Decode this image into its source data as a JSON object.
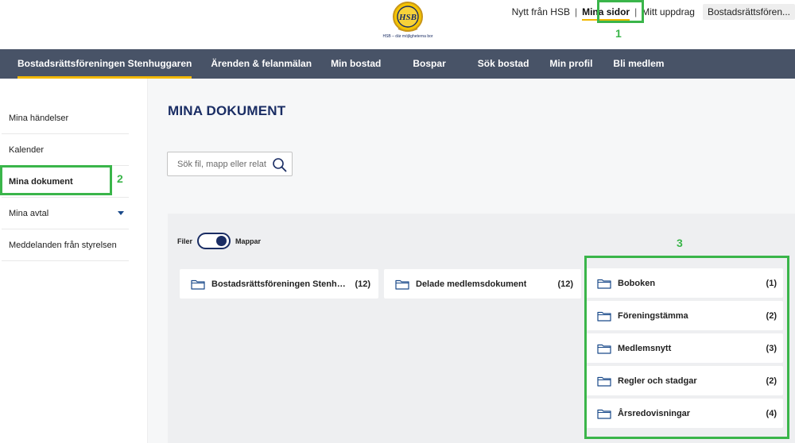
{
  "logo": {
    "text": "HSB",
    "tagline": "HSB – där möjligheterna bor"
  },
  "top_links": [
    {
      "label": "Nytt från HSB"
    },
    {
      "label": "Mina sidor"
    },
    {
      "label": "Mitt uppdrag"
    },
    {
      "label": "Bostadsrättsfören..."
    }
  ],
  "separator": "|",
  "main_nav": [
    {
      "label": "Bostadsrättsföreningen Stenhuggaren"
    },
    {
      "label": "Ärenden & felanmälan"
    },
    {
      "label": "Min bostad"
    },
    {
      "label": "Bospar"
    },
    {
      "label": "Sök bostad"
    },
    {
      "label": "Min profil"
    },
    {
      "label": "Bli medlem"
    }
  ],
  "sidebar": {
    "items": [
      {
        "label": "Mina händelser"
      },
      {
        "label": "Kalender"
      },
      {
        "label": "Mina dokument"
      },
      {
        "label": "Mina avtal"
      },
      {
        "label": "Meddelanden från styrelsen"
      }
    ]
  },
  "main": {
    "title": "MINA DOKUMENT",
    "search": {
      "placeholder": "Sök fil, mapp eller relaterat",
      "value": ""
    },
    "toggle": {
      "left_label": "Filer",
      "right_label": "Mappar"
    },
    "folders": [
      {
        "name": "Bostadsrättsföreningen Stenhuggar...",
        "count": "(12)"
      },
      {
        "name": "Delade medlemsdokument",
        "count": "(12)"
      }
    ],
    "subfolders": [
      {
        "name": "Boboken",
        "count": "(1)"
      },
      {
        "name": "Föreningstämma",
        "count": "(2)"
      },
      {
        "name": "Medlemsnytt",
        "count": "(3)"
      },
      {
        "name": "Regler och stadgar",
        "count": "(2)"
      },
      {
        "name": "Årsredovisningar",
        "count": "(4)"
      }
    ]
  },
  "annotations": [
    {
      "label": "1"
    },
    {
      "label": "2"
    },
    {
      "label": "3"
    }
  ],
  "colors": {
    "nav_bg": "#485367",
    "accent_yellow": "#f2b800",
    "title_navy": "#1a2d64",
    "annotation_green": "#3ab54a",
    "folder_icon": "#1a4a8a"
  }
}
